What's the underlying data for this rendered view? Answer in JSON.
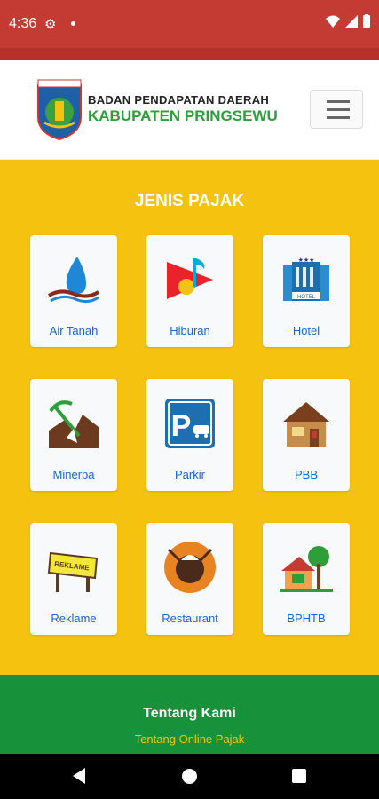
{
  "status": {
    "time": "4:36"
  },
  "header": {
    "org_line1": "BADAN PENDAPATAN DAERAH",
    "org_line2": "KABUPATEN PRINGSEWU",
    "logo_text": "PRINGSEWU"
  },
  "main": {
    "title": "JENIS PAJAK",
    "items": [
      {
        "label": "Air Tanah",
        "icon": "water-drop-icon"
      },
      {
        "label": "Hiburan",
        "icon": "music-play-icon"
      },
      {
        "label": "Hotel",
        "icon": "hotel-building-icon"
      },
      {
        "label": "Minerba",
        "icon": "mining-icon"
      },
      {
        "label": "Parkir",
        "icon": "parking-icon"
      },
      {
        "label": "PBB",
        "icon": "house-icon"
      },
      {
        "label": "Reklame",
        "icon": "billboard-icon"
      },
      {
        "label": "Restaurant",
        "icon": "restaurant-plate-icon"
      },
      {
        "label": "BPHTB",
        "icon": "land-house-icon"
      }
    ]
  },
  "footer": {
    "title": "Tentang Kami",
    "link": "Tentang Online Pajak"
  },
  "colors": {
    "status": "#c33b33",
    "main_bg": "#f5c20f",
    "footer_bg": "#17923b",
    "label": "#1a64d6"
  }
}
